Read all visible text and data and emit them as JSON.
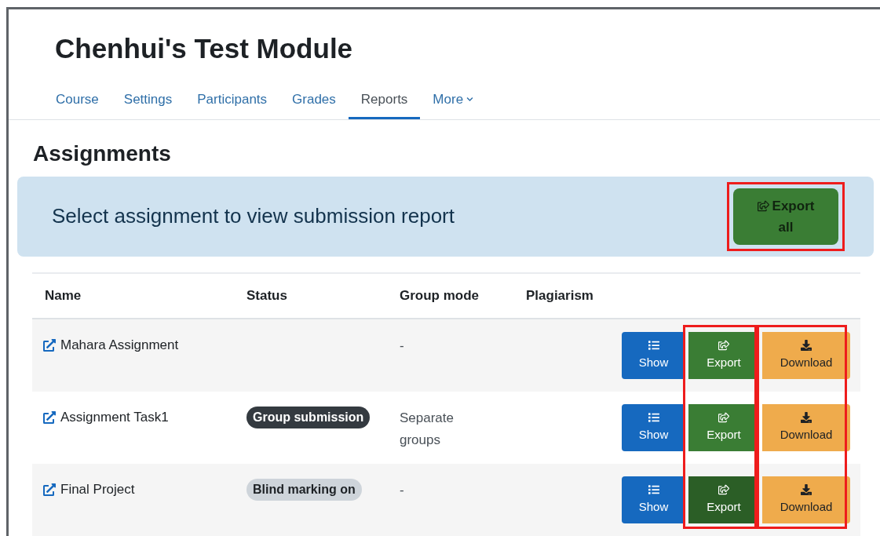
{
  "course_title": "Chenhui's Test Module",
  "tabs": [
    {
      "label": "Course",
      "selected": false,
      "dropdown": false
    },
    {
      "label": "Settings",
      "selected": false,
      "dropdown": false
    },
    {
      "label": "Participants",
      "selected": false,
      "dropdown": false
    },
    {
      "label": "Grades",
      "selected": false,
      "dropdown": false
    },
    {
      "label": "Reports",
      "selected": true,
      "dropdown": false
    },
    {
      "label": "More",
      "selected": false,
      "dropdown": true
    }
  ],
  "page_heading": "Assignments",
  "banner": {
    "text": "Select assignment to view submission report",
    "export_all": {
      "label": "Export all",
      "highlighted": true
    }
  },
  "table": {
    "columns": [
      "Name",
      "Status",
      "Group mode",
      "Plagiarism"
    ],
    "rows": [
      {
        "name": "Mahara Assignment",
        "status": null,
        "group_mode": "-",
        "actions": [
          {
            "kind": "show",
            "label": "Show"
          },
          {
            "kind": "export",
            "label": "Export",
            "pressed": false
          },
          {
            "kind": "download",
            "label": "Download"
          }
        ]
      },
      {
        "name": "Assignment Task1",
        "status": {
          "label": "Group submission",
          "kind": "dark"
        },
        "group_mode": "Separate groups",
        "actions": [
          {
            "kind": "show",
            "label": "Show"
          },
          {
            "kind": "export",
            "label": "Export",
            "pressed": false
          },
          {
            "kind": "download",
            "label": "Download"
          }
        ]
      },
      {
        "name": "Final Project",
        "status": {
          "label": "Blind marking on",
          "kind": "light"
        },
        "group_mode": "-",
        "actions": [
          {
            "kind": "show",
            "label": "Show"
          },
          {
            "kind": "export",
            "label": "Export",
            "pressed": true
          },
          {
            "kind": "download",
            "label": "Download"
          }
        ]
      }
    ],
    "export_column_highlighted": true,
    "download_column_highlighted": true
  }
}
